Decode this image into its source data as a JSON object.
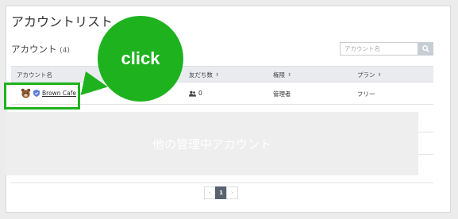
{
  "page": {
    "title": "アカウントリスト"
  },
  "section": {
    "title": "アカウント",
    "count": "(4)"
  },
  "search": {
    "placeholder": "アカウント名"
  },
  "table": {
    "headers": [
      "アカウント名",
      "友だち数",
      "権限",
      "プラン"
    ],
    "rows": [
      {
        "account_name": "Brown Cafe",
        "friends": "0",
        "role": "管理者",
        "plan": "フリー"
      }
    ]
  },
  "overlay": {
    "text": "他の管理中アカウント"
  },
  "pagination": {
    "prev": "‹",
    "current": "1",
    "next": "›"
  },
  "callout": {
    "text": "click",
    "color": "#1fb21f"
  },
  "colors": {
    "highlight": "#1db31d",
    "pager_active": "#5a6170"
  }
}
